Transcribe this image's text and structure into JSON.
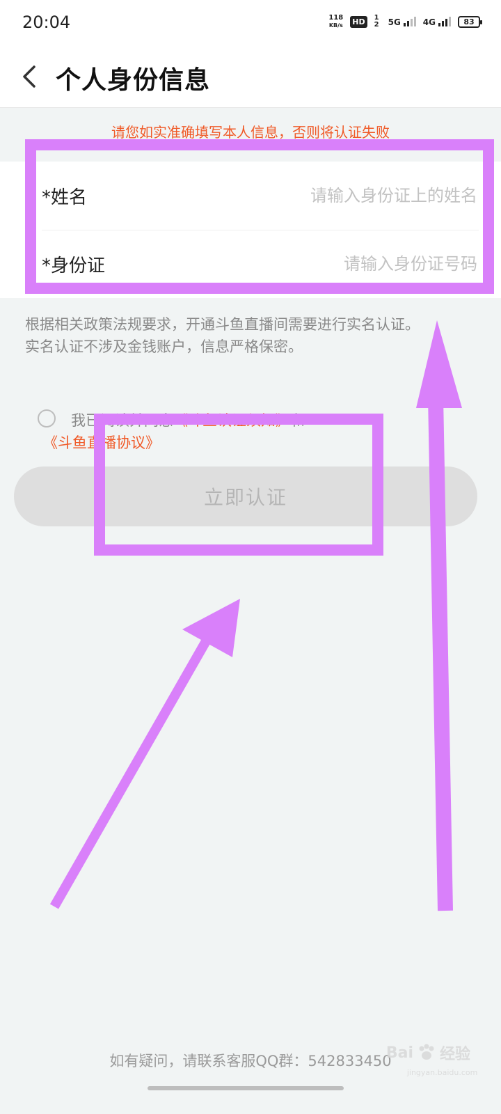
{
  "status_bar": {
    "time": "20:04",
    "net_speed_value": "118",
    "net_speed_unit": "KB/s",
    "hd_label": "HD",
    "sim_slots": "1 2",
    "signal1_label": "5G",
    "signal2_label": "4G",
    "battery_level": "83"
  },
  "header": {
    "title": "个人身份信息"
  },
  "warning_text": "请您如实准确填写本人信息，否则将认证失败",
  "form": {
    "name_label": "*姓名",
    "name_placeholder": "请输入身份证上的姓名",
    "id_label": "*身份证",
    "id_placeholder": "请输入身份证号码"
  },
  "notice": {
    "line1": "根据相关政策法规要求，开通斗鱼直播间需要进行实名认证。",
    "line2": "实名认证不涉及金钱账户，信息严格保密。"
  },
  "agreement": {
    "prefix": "我已阅读并同意",
    "link1": "《斗鱼认证须知》",
    "mid": "和",
    "link2": "《斗鱼直播协议》"
  },
  "submit_label": "立即认证",
  "contact_text": "如有疑问，请联系客服QQ群：542833450",
  "watermark": {
    "logo": "Bai",
    "text": "经验",
    "domain": "jingyan.baidu.com"
  },
  "annotation_color": "#d980fa",
  "accent_color": "#f05a28"
}
